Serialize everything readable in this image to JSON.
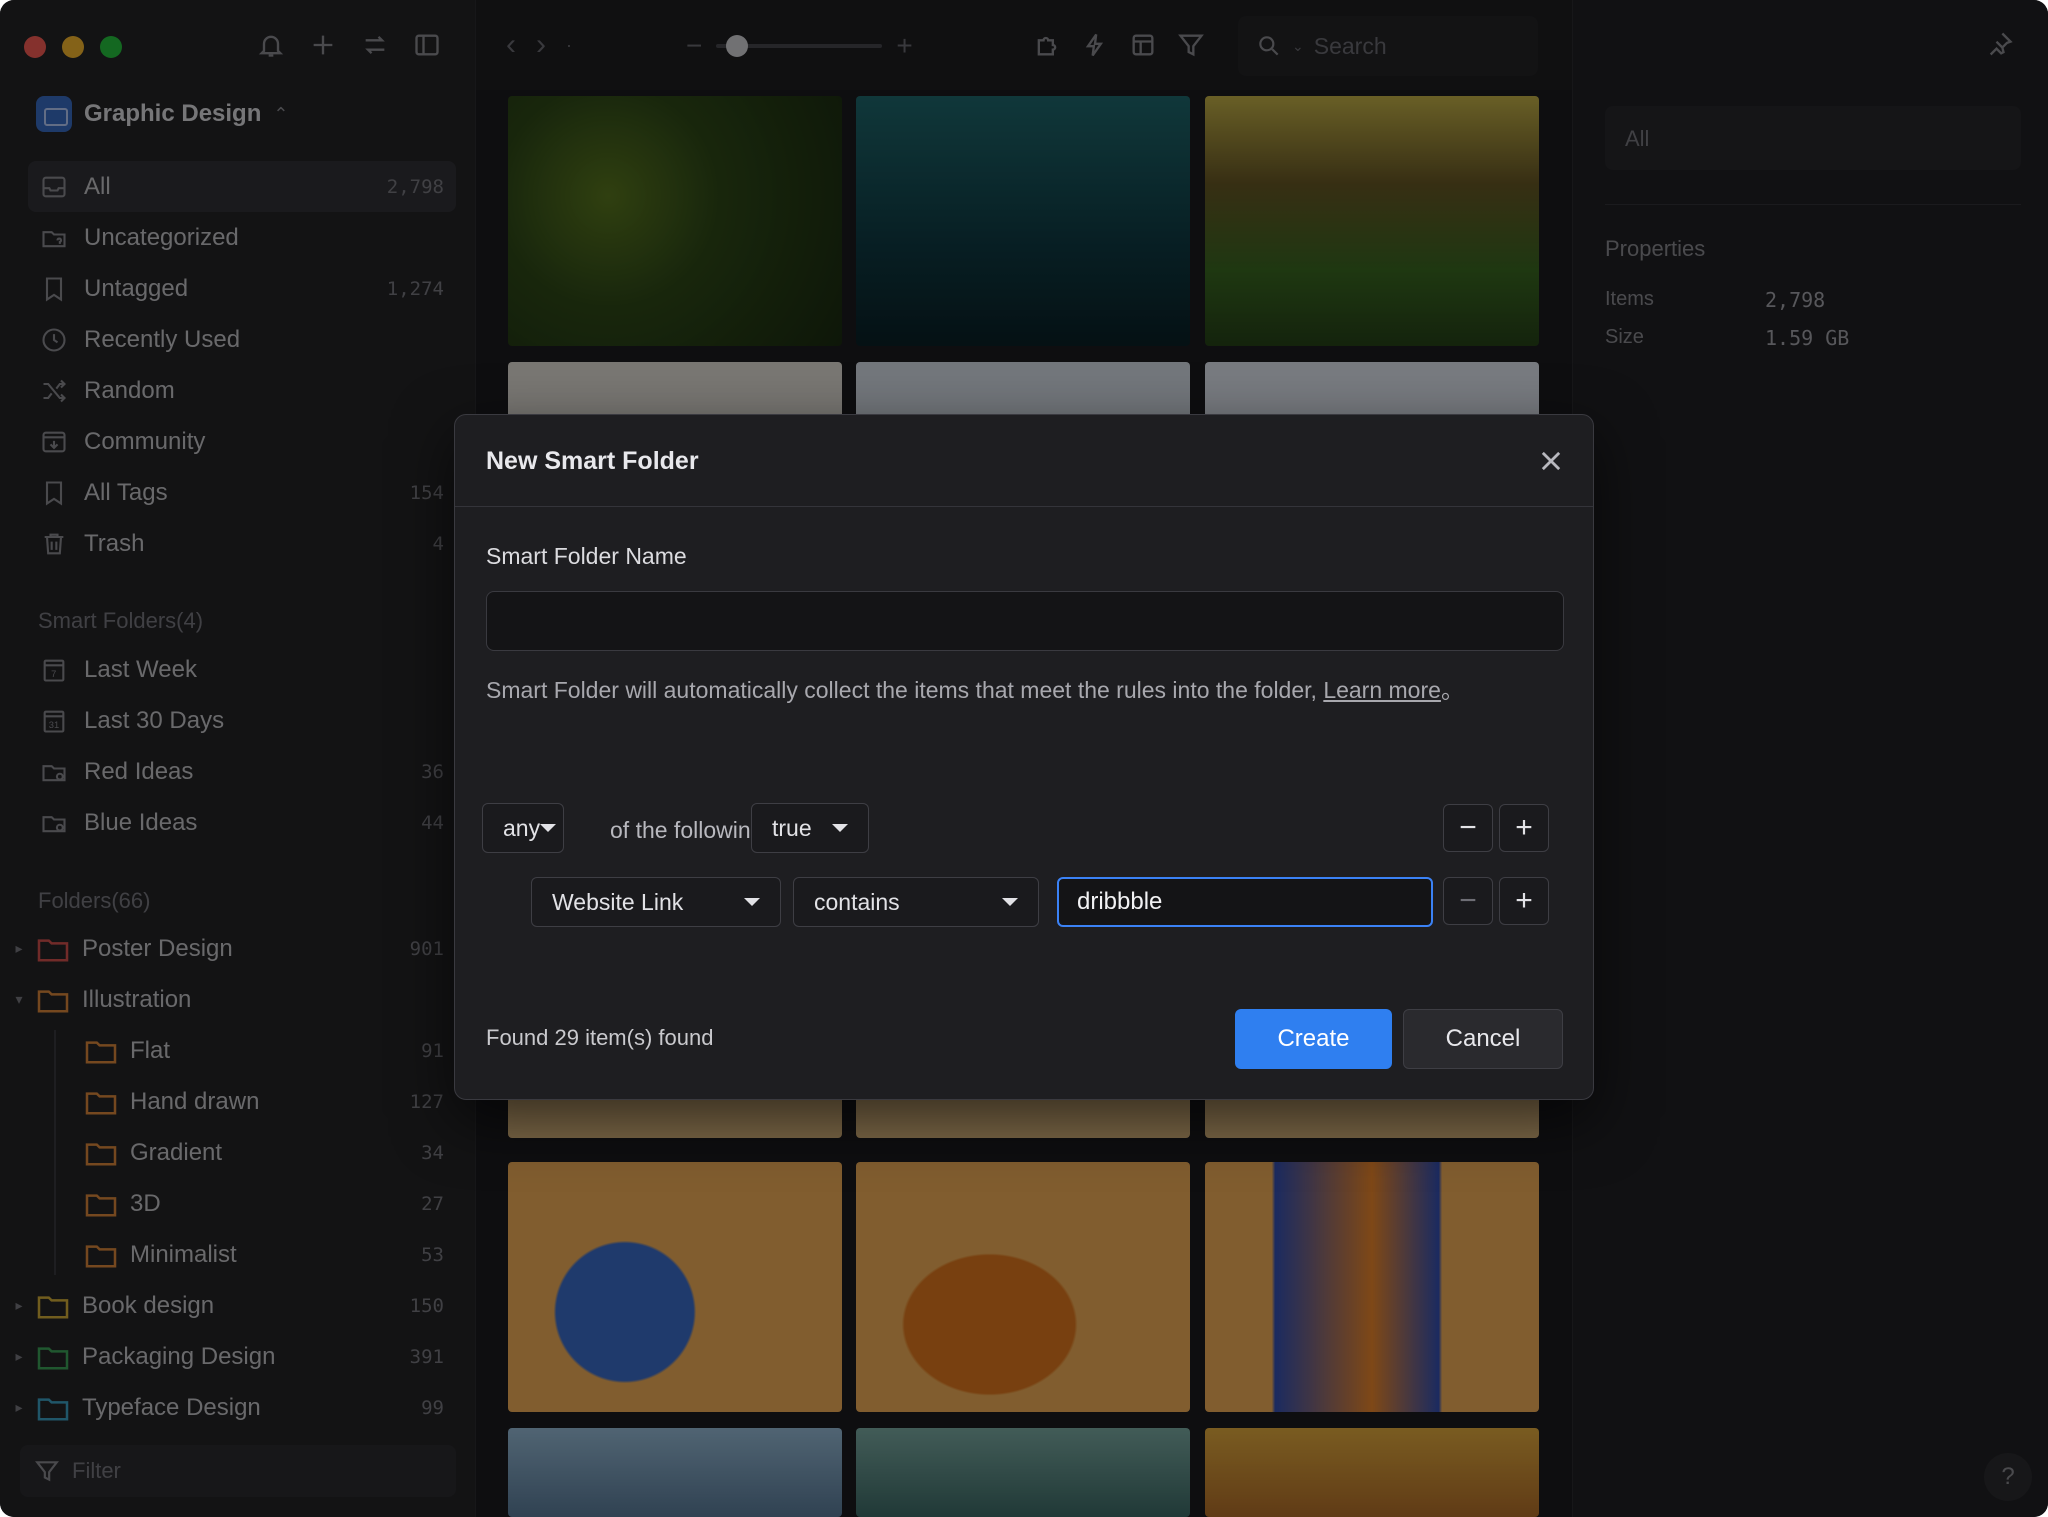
{
  "library": {
    "name": "Graphic Design"
  },
  "nav": [
    {
      "label": "All",
      "count": "2,798",
      "icon": "inbox-icon"
    },
    {
      "label": "Uncategorized",
      "count": "",
      "icon": "folder-question-icon"
    },
    {
      "label": "Untagged",
      "count": "1,274",
      "icon": "tag-question-icon"
    },
    {
      "label": "Recently Used",
      "count": "",
      "icon": "clock-icon"
    },
    {
      "label": "Random",
      "count": "",
      "icon": "shuffle-icon"
    },
    {
      "label": "Community",
      "count": "",
      "icon": "download-box-icon"
    },
    {
      "label": "All Tags",
      "count": "154",
      "icon": "bookmark-icon"
    },
    {
      "label": "Trash",
      "count": "4",
      "icon": "trash-icon"
    }
  ],
  "smart_folders": {
    "title": "Smart Folders(4)",
    "items": [
      {
        "label": "Last Week",
        "count": "",
        "badge": "7"
      },
      {
        "label": "Last 30 Days",
        "count": "",
        "badge": "31"
      },
      {
        "label": "Red Ideas",
        "count": "36"
      },
      {
        "label": "Blue Ideas",
        "count": "44"
      }
    ]
  },
  "folders": {
    "title": "Folders(66)",
    "items": [
      {
        "label": "Poster Design",
        "count": "901",
        "color": "#d9534f"
      },
      {
        "label": "Illustration",
        "count": "",
        "color": "#e08a3c"
      },
      {
        "label": "Flat",
        "count": "91",
        "color": "#e08a3c"
      },
      {
        "label": "Hand drawn",
        "count": "127",
        "color": "#e08a3c"
      },
      {
        "label": "Gradient",
        "count": "34",
        "color": "#e08a3c"
      },
      {
        "label": "3D",
        "count": "27",
        "color": "#e08a3c"
      },
      {
        "label": "Minimalist",
        "count": "53",
        "color": "#e08a3c"
      },
      {
        "label": "Book design",
        "count": "150",
        "color": "#d8b23a"
      },
      {
        "label": "Packaging Design",
        "count": "391",
        "color": "#3fa85a"
      },
      {
        "label": "Typeface Design",
        "count": "99",
        "color": "#3fa6c9"
      }
    ]
  },
  "filter": {
    "placeholder": "Filter"
  },
  "toolbar": {
    "search_placeholder": "Search"
  },
  "right_panel": {
    "name_placeholder": "All",
    "properties_title": "Properties",
    "items_label": "Items",
    "items_value": "2,798",
    "size_label": "Size",
    "size_value": "1.59 GB",
    "help": "?"
  },
  "dialog": {
    "title": "New Smart Folder",
    "name_label": "Smart Folder Name",
    "name_value": "",
    "description": "Smart Folder will automatically collect the items that meet the rules into the folder, ",
    "learn_more": "Learn more",
    "learn_more_suffix": "。",
    "match_mode": "any",
    "match_text": "of the following are",
    "match_bool": "true",
    "rule": {
      "field": "Website Link",
      "operator": "contains",
      "value": "dribbble"
    },
    "found_text": "Found 29 item(s) found",
    "create_label": "Create",
    "cancel_label": "Cancel"
  },
  "colors": {
    "accent": "#2f7ff0",
    "focus": "#3b82f6"
  }
}
